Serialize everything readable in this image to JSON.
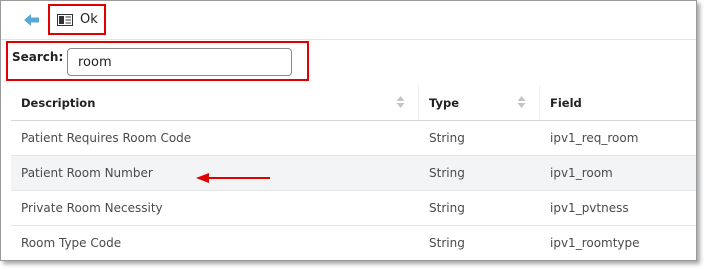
{
  "toolbar": {
    "back_icon": "back-arrow-icon",
    "ok_icon": "document-check-icon",
    "ok_label": "Ok"
  },
  "search": {
    "label": "Search:",
    "value": "room",
    "placeholder": ""
  },
  "table": {
    "columns": [
      {
        "label": "Description",
        "sortable": true
      },
      {
        "label": "Type",
        "sortable": true
      },
      {
        "label": "Field",
        "sortable": false
      }
    ],
    "rows": [
      {
        "description": "Patient Requires Room Code",
        "type": "String",
        "field": "ipv1_req_room"
      },
      {
        "description": "Patient Room Number",
        "type": "String",
        "field": "ipv1_room"
      },
      {
        "description": "Private Room Necessity",
        "type": "String",
        "field": "ipv1_pvtness"
      },
      {
        "description": "Room Type Code",
        "type": "String",
        "field": "ipv1_roomtype"
      }
    ]
  },
  "colors": {
    "highlight_border": "#e00000",
    "back_arrow": "#5aa7d6",
    "row_highlight": "#f2f4f6"
  }
}
